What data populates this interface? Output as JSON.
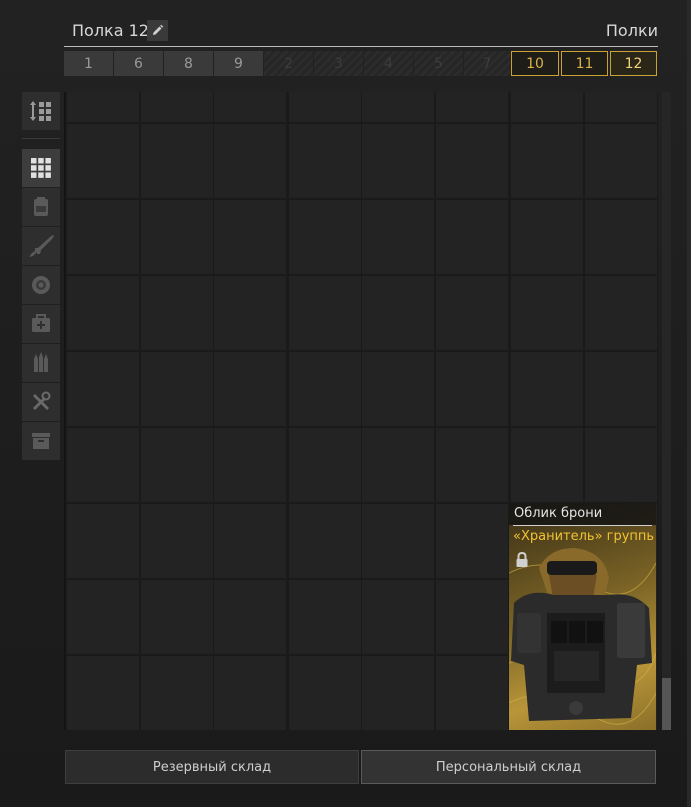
{
  "header": {
    "shelf_title": "Полка 12",
    "shelves_label": "Полки"
  },
  "tabs": [
    {
      "label": "1",
      "state": "normal"
    },
    {
      "label": "6",
      "state": "normal"
    },
    {
      "label": "8",
      "state": "normal"
    },
    {
      "label": "9",
      "state": "normal"
    },
    {
      "label": "2",
      "state": "locked"
    },
    {
      "label": "3",
      "state": "locked"
    },
    {
      "label": "4",
      "state": "locked"
    },
    {
      "label": "5",
      "state": "locked"
    },
    {
      "label": "7",
      "state": "locked"
    },
    {
      "label": "10",
      "state": "gold"
    },
    {
      "label": "11",
      "state": "gold"
    },
    {
      "label": "12",
      "state": "active"
    }
  ],
  "sidebar": {
    "items": [
      {
        "icon": "sort-icon"
      },
      {
        "icon": "all-items-grid-icon"
      },
      {
        "icon": "backpack-icon"
      },
      {
        "icon": "rifle-icon"
      },
      {
        "icon": "armor-icon"
      },
      {
        "icon": "medkit-icon"
      },
      {
        "icon": "ammo-icon"
      },
      {
        "icon": "tools-icon"
      },
      {
        "icon": "misc-box-icon"
      }
    ],
    "active_index": 1
  },
  "item": {
    "type_label": "Облик брони",
    "name": "«Хранитель» группы ..",
    "locked": true
  },
  "bottom_tabs": {
    "reserve_label": "Резервный склад",
    "personal_label": "Персональный склад"
  },
  "colors": {
    "accent_gold": "#c9a233",
    "item_name": "#f1c232"
  }
}
